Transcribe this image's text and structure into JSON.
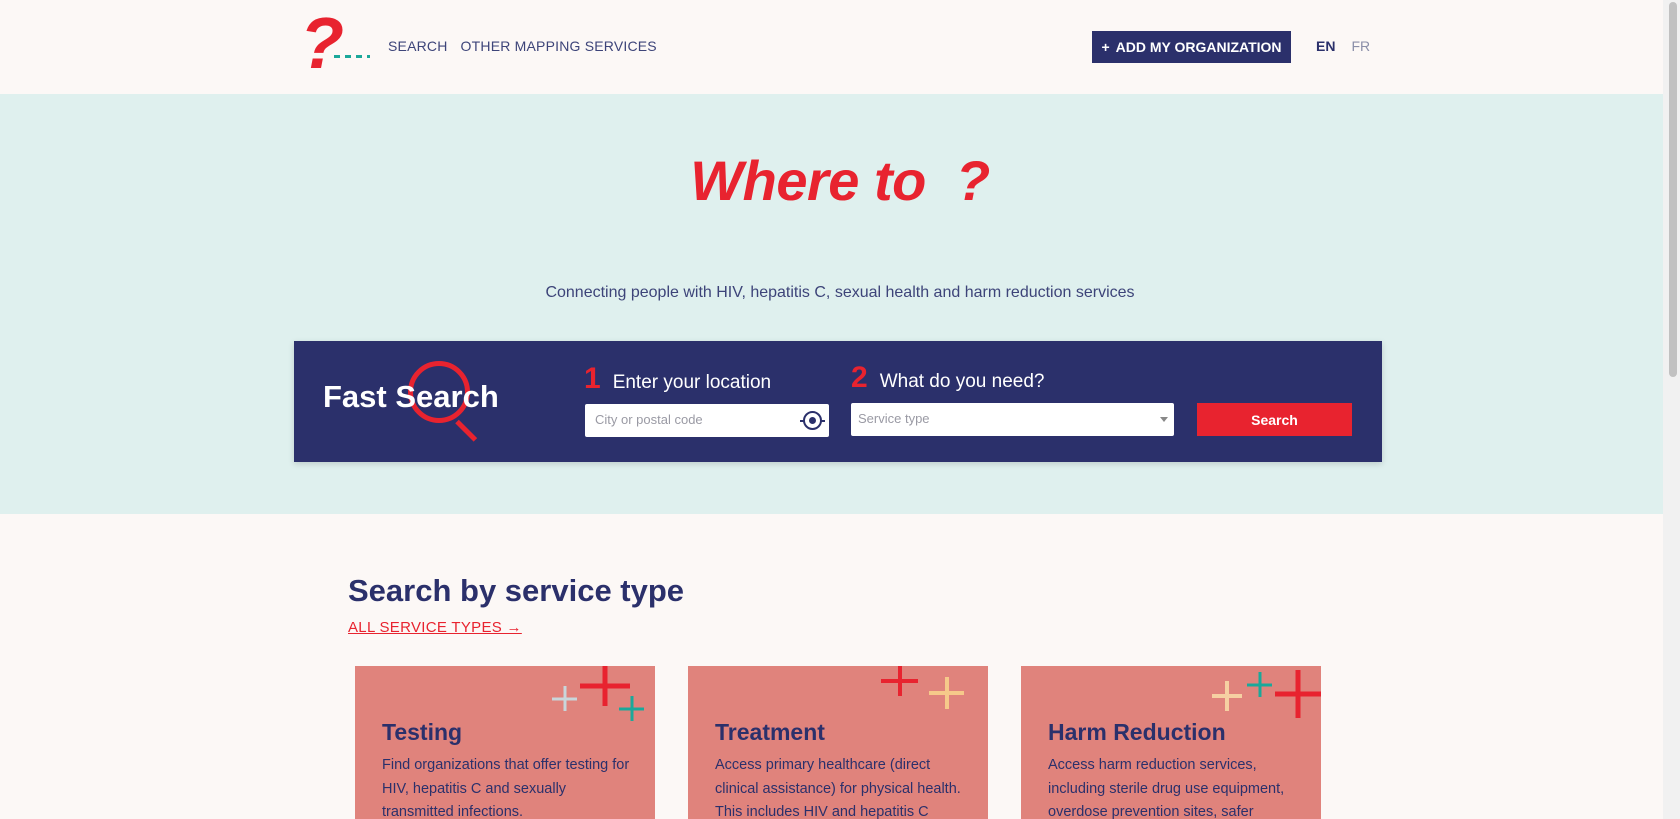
{
  "header": {
    "logo_alt": "?",
    "nav": [
      {
        "label": "SEARCH"
      },
      {
        "label": "OTHER MAPPING SERVICES"
      }
    ],
    "add_org_label": "ADD MY ORGANIZATION",
    "add_org_icon": "+",
    "languages": [
      {
        "label": "EN",
        "active": true
      },
      {
        "label": "FR",
        "active": false
      }
    ]
  },
  "hero": {
    "title": "Where to  ?",
    "subtitle": "Connecting people with HIV, hepatitis C, sexual health and harm reduction services"
  },
  "fast_search": {
    "title": "Fast Search",
    "step1": {
      "num": "1",
      "label": "Enter your location",
      "placeholder": "City or postal code"
    },
    "step2": {
      "num": "2",
      "label": "What do you need?",
      "placeholder": "Service type"
    },
    "button": "Search"
  },
  "service_types": {
    "heading": "Search by service type",
    "all_link": "ALL SERVICE TYPES →",
    "cards": [
      {
        "title": "Testing",
        "text": "Find organizations that offer testing for HIV, hepatitis C and sexually transmitted infections."
      },
      {
        "title": "Treatment",
        "text": "Access primary healthcare (direct clinical assistance) for physical health. This includes HIV and hepatitis C"
      },
      {
        "title": "Harm Reduction",
        "text": "Access harm reduction services, including sterile drug use equipment, overdose prevention sites, safer"
      }
    ]
  },
  "colors": {
    "navy": "#2b306b",
    "red": "#e8232f",
    "teal": "#1ba89a",
    "hero_bg": "#dff0ee",
    "card_bg": "#e0837c"
  }
}
